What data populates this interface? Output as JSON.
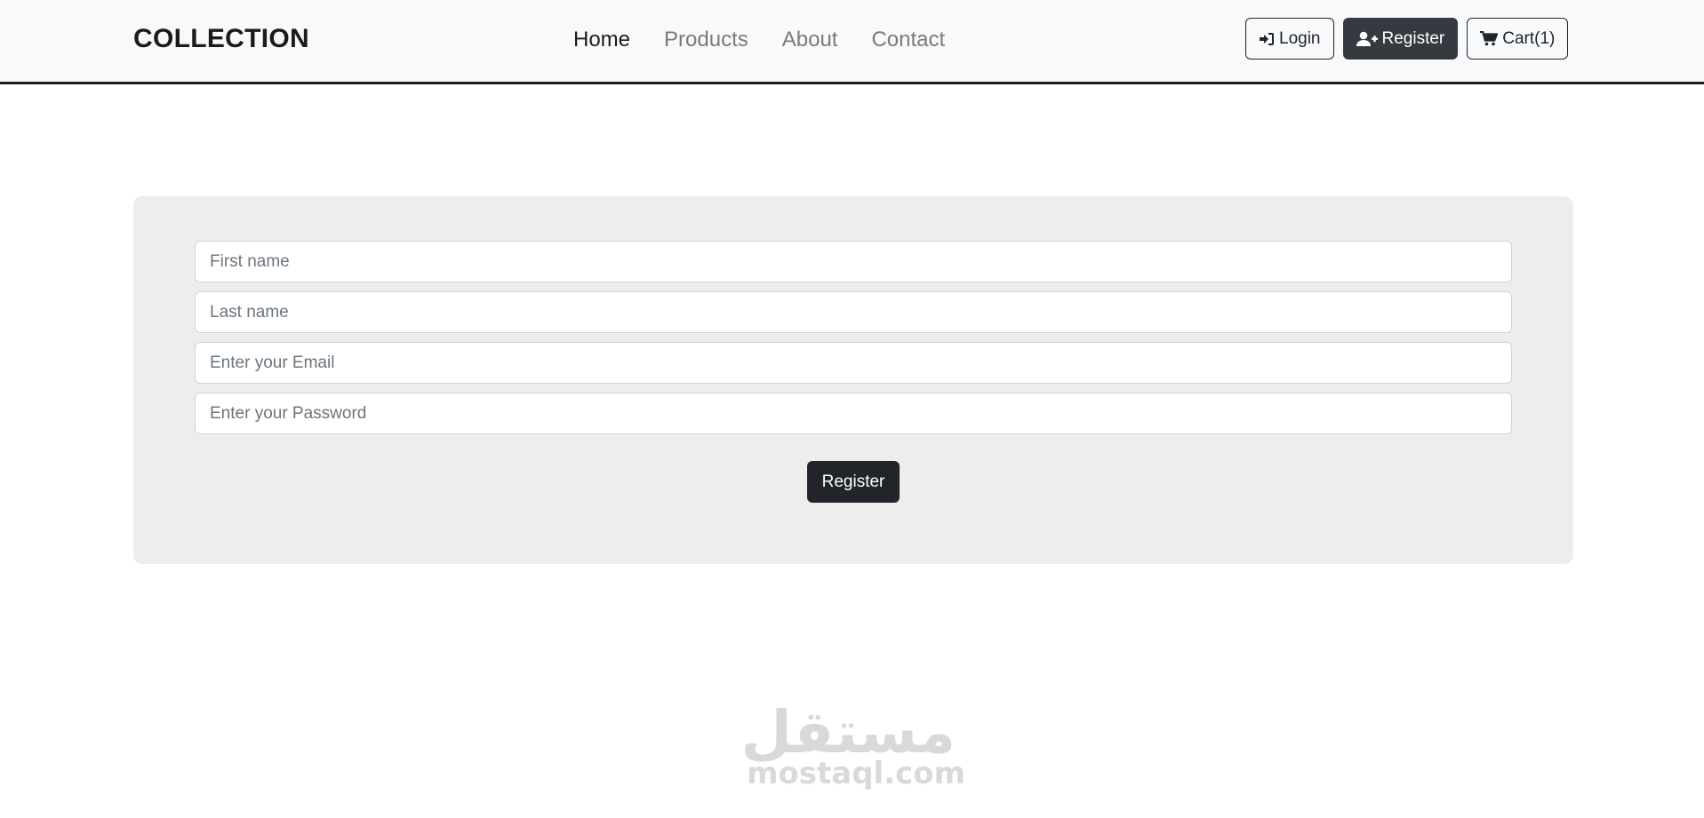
{
  "navbar": {
    "brand": "COLLECTION",
    "links": [
      {
        "label": "Home",
        "active": true
      },
      {
        "label": "Products",
        "active": false
      },
      {
        "label": "About",
        "active": false
      },
      {
        "label": "Contact",
        "active": false
      }
    ],
    "buttons": {
      "login": {
        "label": "Login",
        "icon": "sign-in-icon"
      },
      "register": {
        "label": "Register",
        "icon": "user-plus-icon"
      },
      "cart": {
        "label": "Cart(1)",
        "icon": "cart-icon"
      }
    }
  },
  "form": {
    "first_name": {
      "placeholder": "First name",
      "value": ""
    },
    "last_name": {
      "placeholder": "Last name",
      "value": ""
    },
    "email": {
      "placeholder": "Enter your Email",
      "value": ""
    },
    "password": {
      "placeholder": "Enter your Password",
      "value": ""
    },
    "submit_label": "Register"
  },
  "watermark": {
    "arabic": "مستقل",
    "latin": "mostaql.com"
  },
  "colors": {
    "navbar_bg": "#f8f9fa",
    "panel_bg": "#ededed",
    "dark_button": "#212529",
    "register_button": "#343a40",
    "watermark": "#d9d9d9"
  }
}
